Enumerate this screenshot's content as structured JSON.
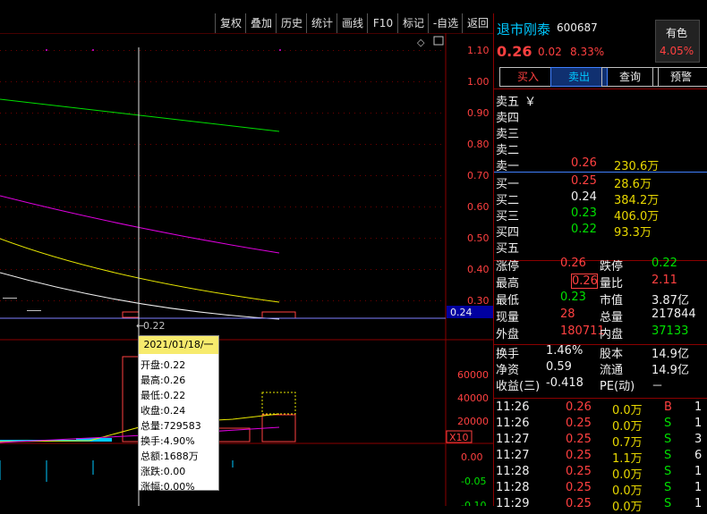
{
  "toolbar": {
    "items": [
      "复权",
      "叠加",
      "历史",
      "统计",
      "画线",
      "F10",
      "标记",
      "-自选",
      "返回"
    ]
  },
  "chart": {
    "right_axis_top": [
      "1.10",
      "1.00",
      "0.90",
      "0.80",
      "0.70",
      "0.60",
      "0.50",
      "0.40",
      "0.30"
    ],
    "price_marker": "0.24",
    "crosshair_label": "0.22",
    "volume_axis": [
      "60000",
      "40000",
      "20000"
    ],
    "volume_unit": "X10",
    "macd_axis": [
      "0.00",
      "-0.05",
      "-0.10"
    ]
  },
  "tooltip": {
    "date": "2021/01/18/一",
    "rows": [
      "开盘:0.22",
      "最高:0.26",
      "最低:0.22",
      "收盘:0.24",
      "总量:729583",
      "换手:4.90%",
      "总额:1688万",
      "涨跌:0.00",
      "涨幅:0.00%"
    ]
  },
  "quote": {
    "name": "退市刚泰",
    "code": "600687",
    "price": "0.26",
    "change": "0.02",
    "change_pct": "8.33%",
    "sector_name": "有色",
    "sector_pct": "4.05%",
    "buttons": [
      "买入",
      "卖出",
      "查询",
      "预警"
    ],
    "sell_labels": [
      "卖五",
      "卖四",
      "卖三",
      "卖二",
      "卖一"
    ],
    "sell_prices": [
      "",
      "",
      "",
      "",
      "0.26"
    ],
    "sell_vols": [
      "",
      "",
      "",
      "",
      "230.6万"
    ],
    "yen": "￥",
    "buy_labels": [
      "买一",
      "买二",
      "买三",
      "买四",
      "买五"
    ],
    "buy_prices": [
      "0.25",
      "0.24",
      "0.23",
      "0.22",
      ""
    ],
    "buy_vols": [
      "28.6万",
      "384.2万",
      "406.0万",
      "93.3万",
      ""
    ],
    "stats_left": [
      {
        "label": "涨停",
        "value": "0.26"
      },
      {
        "label": "最高",
        "value": "0.26"
      },
      {
        "label": "最低",
        "value": "0.23"
      },
      {
        "label": "现量",
        "value": "28"
      },
      {
        "label": "外盘",
        "value": "180711"
      }
    ],
    "stats_right": [
      {
        "label": "跌停",
        "value": "0.22"
      },
      {
        "label": "量比",
        "value": "2.11"
      },
      {
        "label": "市值",
        "value": "3.87亿"
      },
      {
        "label": "总量",
        "value": "217844"
      },
      {
        "label": "内盘",
        "value": "37133"
      }
    ],
    "fin_left": [
      {
        "label": "换手",
        "value": "1.46%"
      },
      {
        "label": "净资",
        "value": "0.59"
      },
      {
        "label": "收益(三)",
        "value": "-0.418"
      }
    ],
    "fin_right": [
      {
        "label": "股本",
        "value": "14.9亿"
      },
      {
        "label": "流通",
        "value": "14.9亿"
      },
      {
        "label": "PE(动)",
        "value": "－"
      }
    ],
    "ticks": [
      {
        "time": "11:26",
        "price": "0.26",
        "vol": "0.0万",
        "side": "B",
        "n": "1"
      },
      {
        "time": "11:26",
        "price": "0.25",
        "vol": "0.0万",
        "side": "S",
        "n": "1"
      },
      {
        "time": "11:27",
        "price": "0.25",
        "vol": "0.7万",
        "side": "S",
        "n": "3"
      },
      {
        "time": "11:27",
        "price": "0.25",
        "vol": "1.1万",
        "side": "S",
        "n": "6"
      },
      {
        "time": "11:28",
        "price": "0.25",
        "vol": "0.0万",
        "side": "S",
        "n": "1"
      },
      {
        "time": "11:28",
        "price": "0.25",
        "vol": "0.0万",
        "side": "S",
        "n": "1"
      },
      {
        "time": "11:29",
        "price": "0.25",
        "vol": "0.0万",
        "side": "S",
        "n": "1"
      }
    ]
  },
  "colors": {
    "up": "#ff4040",
    "down": "#00e000",
    "bg": "#000000",
    "grid": "#8b0000",
    "ma5": "#f0f0f0",
    "ma10": "#e8e800",
    "ma20": "#e000e0",
    "ma60": "#00e000"
  }
}
